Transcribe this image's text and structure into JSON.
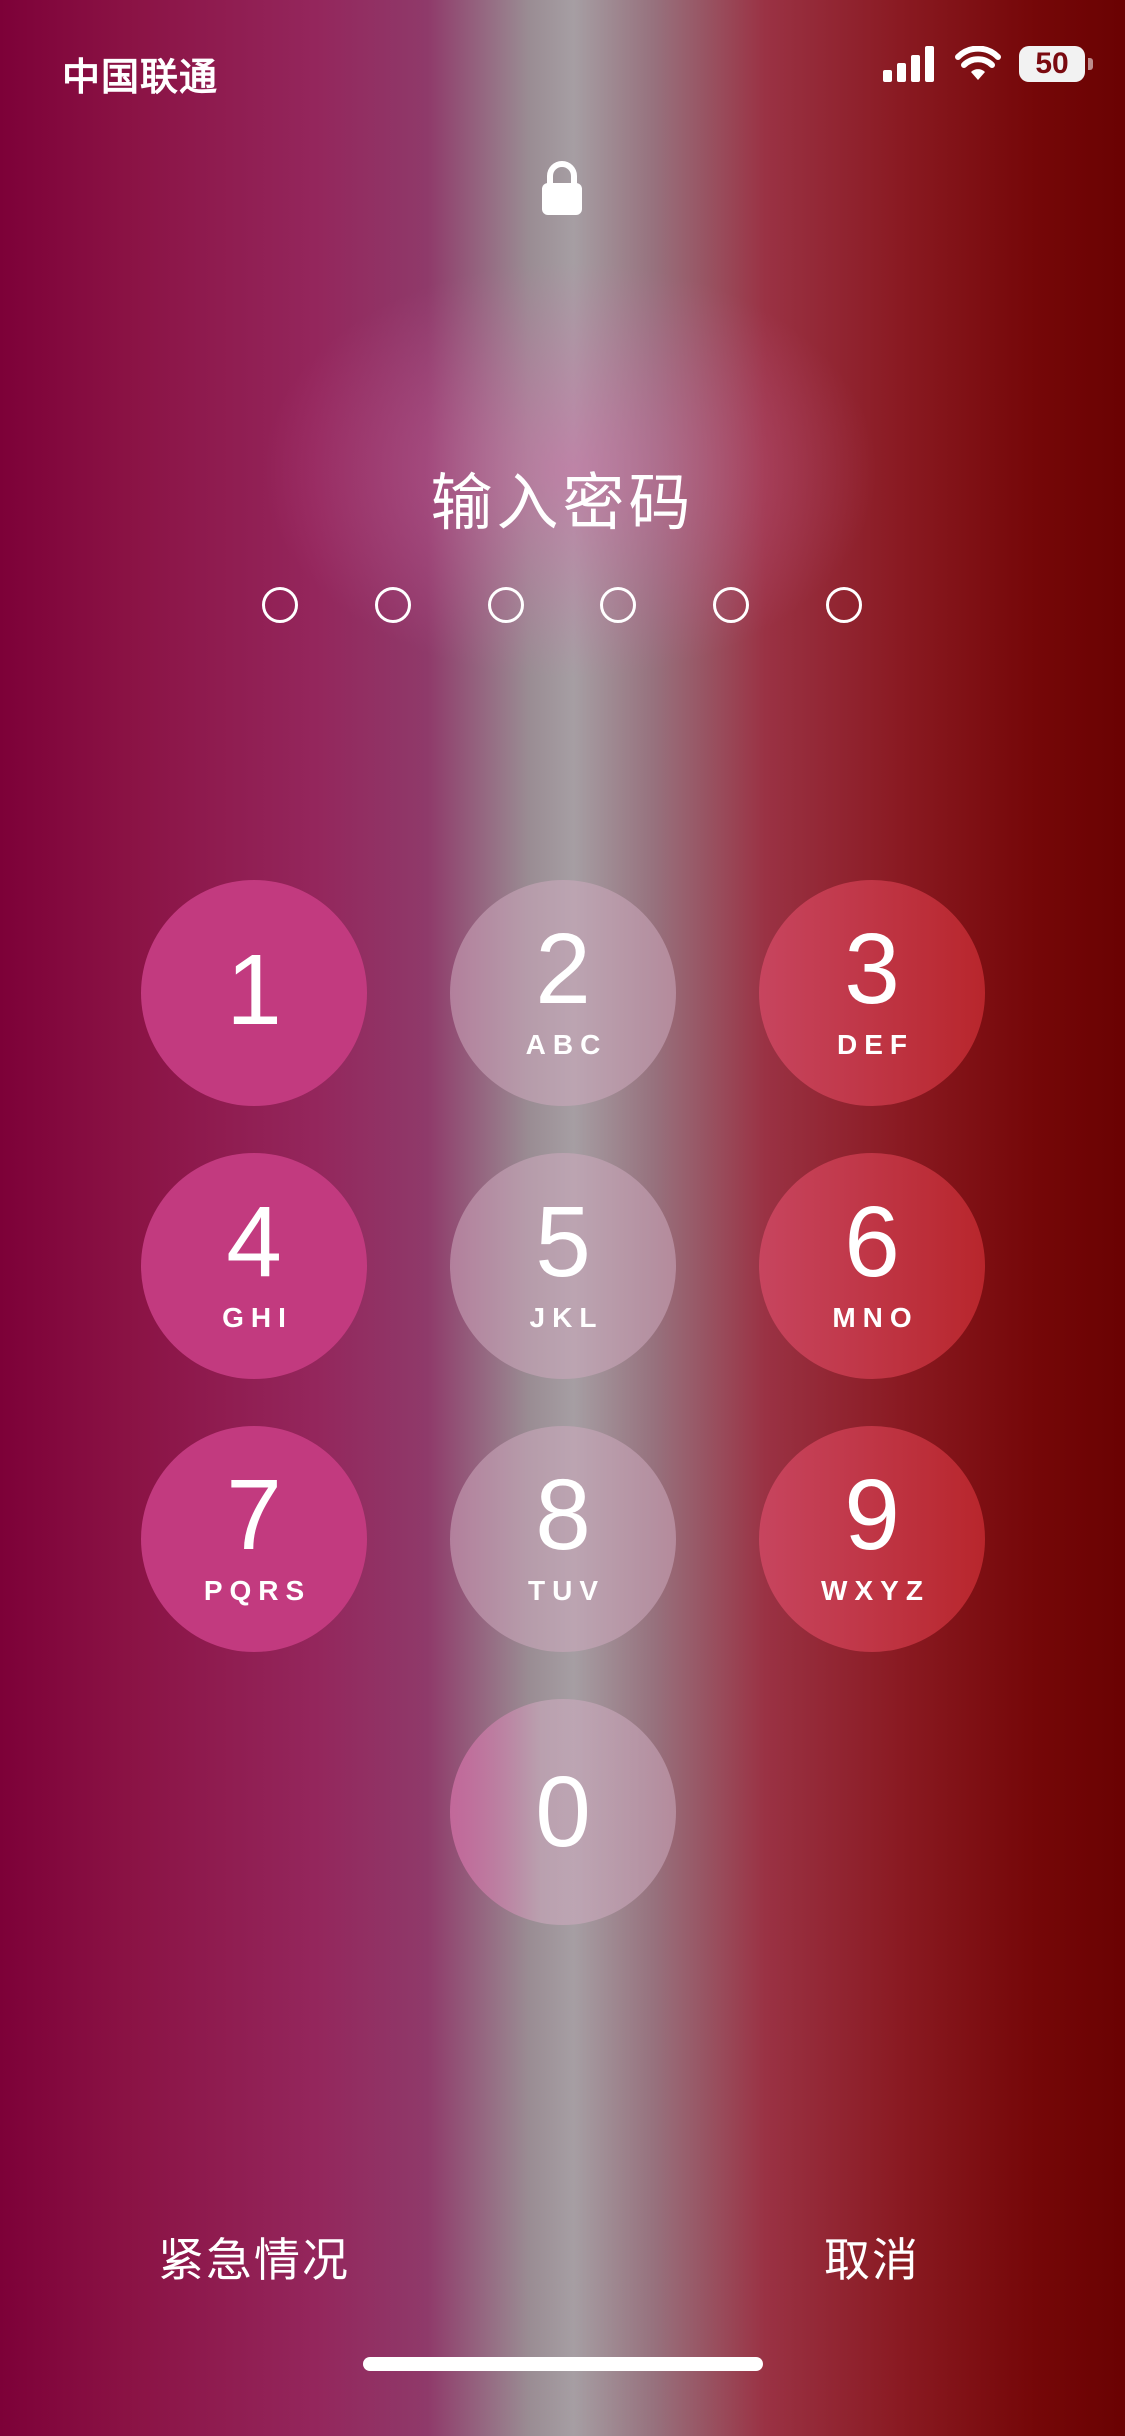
{
  "status_bar": {
    "carrier": "中国联通",
    "battery_level": "50",
    "icons": [
      "signal-icon",
      "wifi-icon",
      "battery-icon"
    ]
  },
  "lock_screen": {
    "lock_icon": "lock-icon",
    "title": "输入密码",
    "passcode_length": 6,
    "entered_digits": 0
  },
  "keypad": {
    "keys": [
      {
        "digit": "1",
        "letters": ""
      },
      {
        "digit": "2",
        "letters": "ABC"
      },
      {
        "digit": "3",
        "letters": "DEF"
      },
      {
        "digit": "4",
        "letters": "GHI"
      },
      {
        "digit": "5",
        "letters": "JKL"
      },
      {
        "digit": "6",
        "letters": "MNO"
      },
      {
        "digit": "7",
        "letters": "PQRS"
      },
      {
        "digit": "8",
        "letters": "TUV"
      },
      {
        "digit": "9",
        "letters": "WXYZ"
      },
      {
        "digit": "0",
        "letters": ""
      }
    ]
  },
  "actions": {
    "emergency": "紧急情况",
    "cancel": "取消"
  },
  "colors": {
    "left_key": "#c23a7f",
    "middle_key": "#cdaabe",
    "right_key": "#b8262c"
  }
}
